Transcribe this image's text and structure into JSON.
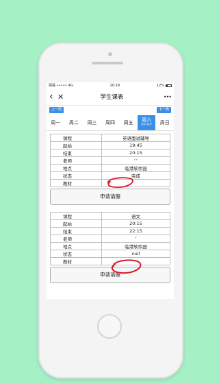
{
  "status_bar": {
    "carrier": "探探",
    "signal_dots": "•••••",
    "network": "4G",
    "time": "20:18",
    "battery": "12%",
    "battery_icon": "battery-icon"
  },
  "navbar": {
    "back_icon": "‹",
    "close_icon": "✕",
    "title": "学生课表",
    "more_icon": "•••"
  },
  "week_nav": {
    "prev_label": "上一周",
    "next_label": "下一周"
  },
  "days": [
    {
      "label": "周一"
    },
    {
      "label": "周二"
    },
    {
      "label": "周三"
    },
    {
      "label": "周四"
    },
    {
      "label": "周五"
    },
    {
      "label": "周六",
      "date": "07-07",
      "active": true
    },
    {
      "label": "周日"
    }
  ],
  "field_labels": {
    "course": "课程",
    "start": "起始",
    "end": "结束",
    "teacher": "老师",
    "location": "地点",
    "status": "状态",
    "material": "教材"
  },
  "courses": [
    {
      "course": "英语面试辅导",
      "start": "19:45",
      "end": "20:15",
      "teacher": "ᐟᐟ",
      "location": "临港软件园",
      "status": "完成",
      "material": "",
      "button_label": "申请请假"
    },
    {
      "course": "语文",
      "start": "20:15",
      "end": "22:15",
      "teacher": "ᐟ",
      "location": "临港软件园",
      "status": "null",
      "material": "",
      "button_label": "申请请假"
    }
  ],
  "colors": {
    "background": "#a6f0c6",
    "accent": "#3b8fe6",
    "annotation": "#d6182a"
  }
}
